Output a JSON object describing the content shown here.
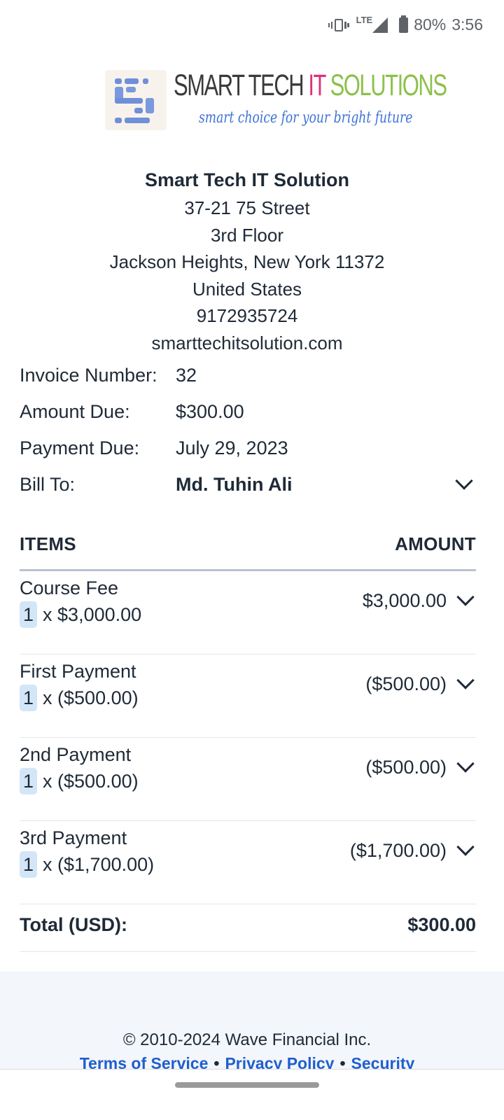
{
  "status_bar": {
    "network": "LTE",
    "battery": "80%",
    "time": "3:56"
  },
  "logo": {
    "word1": "SMART TECH",
    "word2": "IT",
    "word3": "SOLUTIONS",
    "tagline": "smart choice for your bright future"
  },
  "business": {
    "name": "Smart Tech IT Solution",
    "address_lines": [
      "37-21 75 Street",
      "3rd Floor",
      "Jackson Heights, New York 11372",
      "United States",
      "9172935724",
      "smarttechitsolution.com"
    ]
  },
  "invoice": {
    "number_label": "Invoice Number:",
    "number": "32",
    "amount_due_label": "Amount Due:",
    "amount_due": "$300.00",
    "payment_due_label": "Payment Due:",
    "payment_due": "July 29, 2023",
    "bill_to_label": "Bill To:",
    "bill_to": "Md. Tuhin Ali"
  },
  "items_header": {
    "left": "ITEMS",
    "right": "AMOUNT"
  },
  "items": [
    {
      "name": "Course Fee",
      "qty": "1",
      "unit": "x $3,000.00",
      "amount": "$3,000.00"
    },
    {
      "name": "First Payment",
      "qty": "1",
      "unit": "x ($500.00)",
      "amount": "($500.00)"
    },
    {
      "name": "2nd Payment",
      "qty": "1",
      "unit": "x ($500.00)",
      "amount": "($500.00)"
    },
    {
      "name": "3rd Payment",
      "qty": "1",
      "unit": "x ($1,700.00)",
      "amount": "($1,700.00)"
    }
  ],
  "total": {
    "label": "Total (USD):",
    "value": "$300.00"
  },
  "footer": {
    "copyright": "© 2010-2024 Wave Financial Inc.",
    "links": [
      "Terms of Service",
      "Privacy Policy",
      "Security"
    ],
    "separator": "•"
  }
}
